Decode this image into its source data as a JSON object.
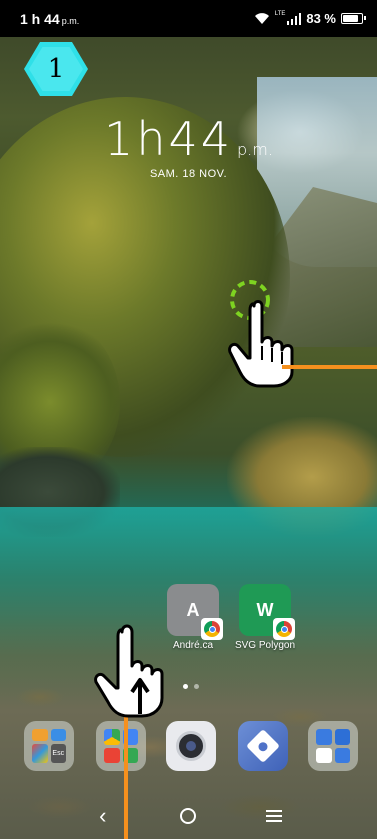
{
  "status_bar": {
    "time": "1 h 44",
    "time_suffix": "p.m.",
    "network_label": "LTE",
    "battery": "83 %",
    "battery_level": 0.83
  },
  "step_badge": {
    "number": "1"
  },
  "lock_clock": {
    "time": "1h44",
    "ampm": "p.m.",
    "date": "SAM. 18 NOV."
  },
  "home_apps": [
    {
      "name": "andre-shortcut",
      "label": "André.ca",
      "glyph": "A",
      "color": "#8a8c8e",
      "icon": "chrome-badge-icon"
    },
    {
      "name": "svg-polygon-shortcut",
      "label": "SVG Polygon",
      "glyph": "W",
      "color": "#1f9a55",
      "icon": "chrome-badge-icon"
    }
  ],
  "dock": [
    {
      "name": "folder-tools",
      "icon": "folder-icon",
      "tile_label": "Esc"
    },
    {
      "name": "folder-google",
      "icon": "folder-icon"
    },
    {
      "name": "camera",
      "icon": "camera-icon"
    },
    {
      "name": "settings",
      "icon": "settings-icon"
    },
    {
      "name": "folder-contacts",
      "icon": "folder-icon"
    }
  ],
  "nav": {
    "back": "‹",
    "home": "home-circle-icon",
    "recents": "menu-lines-icon"
  },
  "colors": {
    "accent_orange": "#f5901e",
    "badge_cyan": "#2fe0e8",
    "tap_ring": "#7ed321"
  }
}
